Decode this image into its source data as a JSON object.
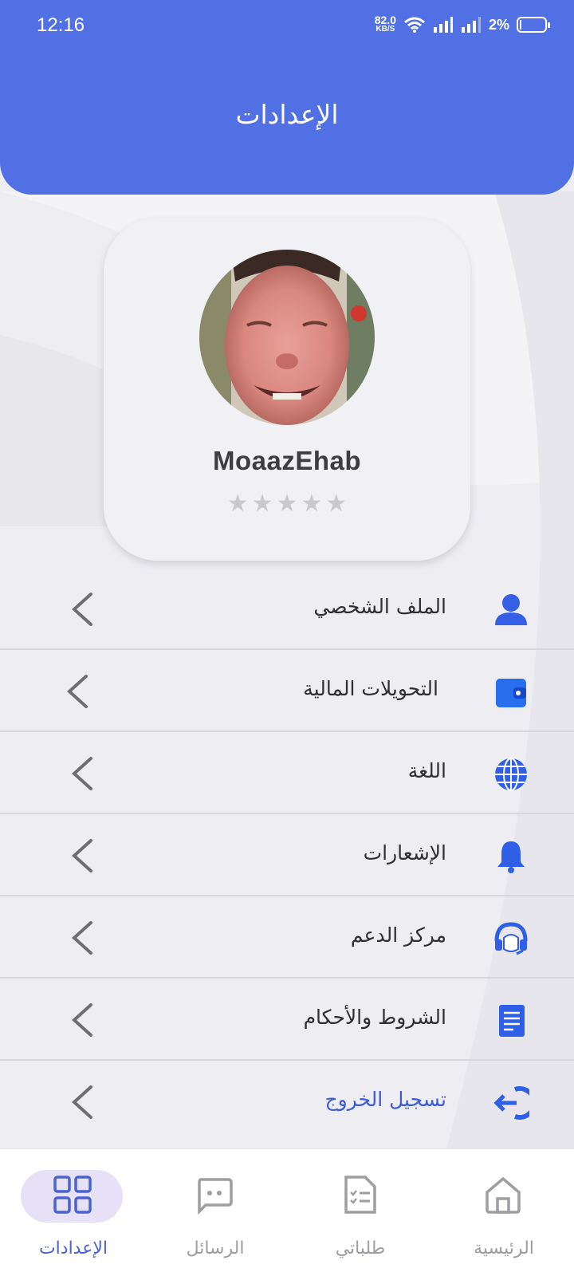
{
  "status_bar": {
    "time": "12:16",
    "net_speed": "82.0",
    "net_unit": "KB/S",
    "battery": "2%"
  },
  "header": {
    "title": "الإعدادات"
  },
  "profile": {
    "username": "MoaazEhab",
    "rating": 0,
    "rating_max": 5,
    "stars": [
      "★",
      "★",
      "★",
      "★",
      "★"
    ]
  },
  "menu": {
    "items": [
      {
        "label": "الملف الشخصي",
        "icon": "user-icon"
      },
      {
        "label": "التحويلات المالية",
        "icon": "wallet-icon"
      },
      {
        "label": "اللغة",
        "icon": "globe-icon"
      },
      {
        "label": "الإشعارات",
        "icon": "bell-icon"
      },
      {
        "label": "مركز الدعم",
        "icon": "headset-icon"
      },
      {
        "label": "الشروط والأحكام",
        "icon": "document-icon"
      },
      {
        "label": "تسجيل الخروج",
        "icon": "logout-icon"
      }
    ]
  },
  "bottom_nav": {
    "items": [
      {
        "label": "الرئيسية",
        "icon": "home-icon"
      },
      {
        "label": "طلباتي",
        "icon": "orders-icon"
      },
      {
        "label": "الرسائل",
        "icon": "messages-icon"
      },
      {
        "label": "الإعدادات",
        "icon": "grid-icon",
        "active": true
      }
    ]
  },
  "colors": {
    "header": "#5170e3",
    "accent": "#4a63cf",
    "active_pill": "#e6e1f6",
    "background": "#ededf2"
  }
}
